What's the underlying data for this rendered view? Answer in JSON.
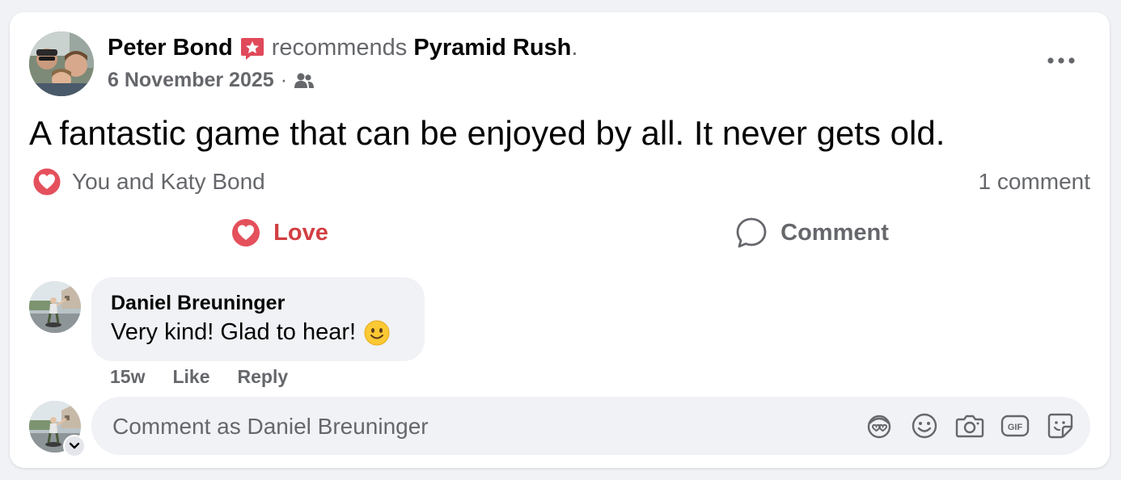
{
  "post": {
    "author": "Peter Bond",
    "verb": "recommends",
    "page": "Pyramid Rush",
    "period": ".",
    "date": "6 November 2025",
    "separator": "·",
    "text": "A fantastic game that can be enjoyed by all. It never gets old.",
    "audience_icon": "friends-icon",
    "badge_icon": "recommend-star-icon"
  },
  "reactions": {
    "icon": "love-reaction-icon",
    "names": "You and Katy Bond",
    "comment_count": "1 comment"
  },
  "actions": {
    "love_label": "Love",
    "comment_label": "Comment"
  },
  "comment": {
    "author": "Daniel Breuninger",
    "text": "Very kind! Glad to hear!",
    "emoji_icon": "smiling-face-icon",
    "age": "15w",
    "like_label": "Like",
    "reply_label": "Reply"
  },
  "composer": {
    "placeholder": "Comment as Daniel Breuninger",
    "tools": [
      "avatar-sticker-icon",
      "emoji-icon",
      "camera-icon",
      "gif-icon",
      "sticker-icon"
    ]
  },
  "colors": {
    "love": "#d23f43",
    "muted": "#65676b",
    "text": "#050505",
    "bubble": "#f0f2f5",
    "badge": "#e0495a"
  }
}
